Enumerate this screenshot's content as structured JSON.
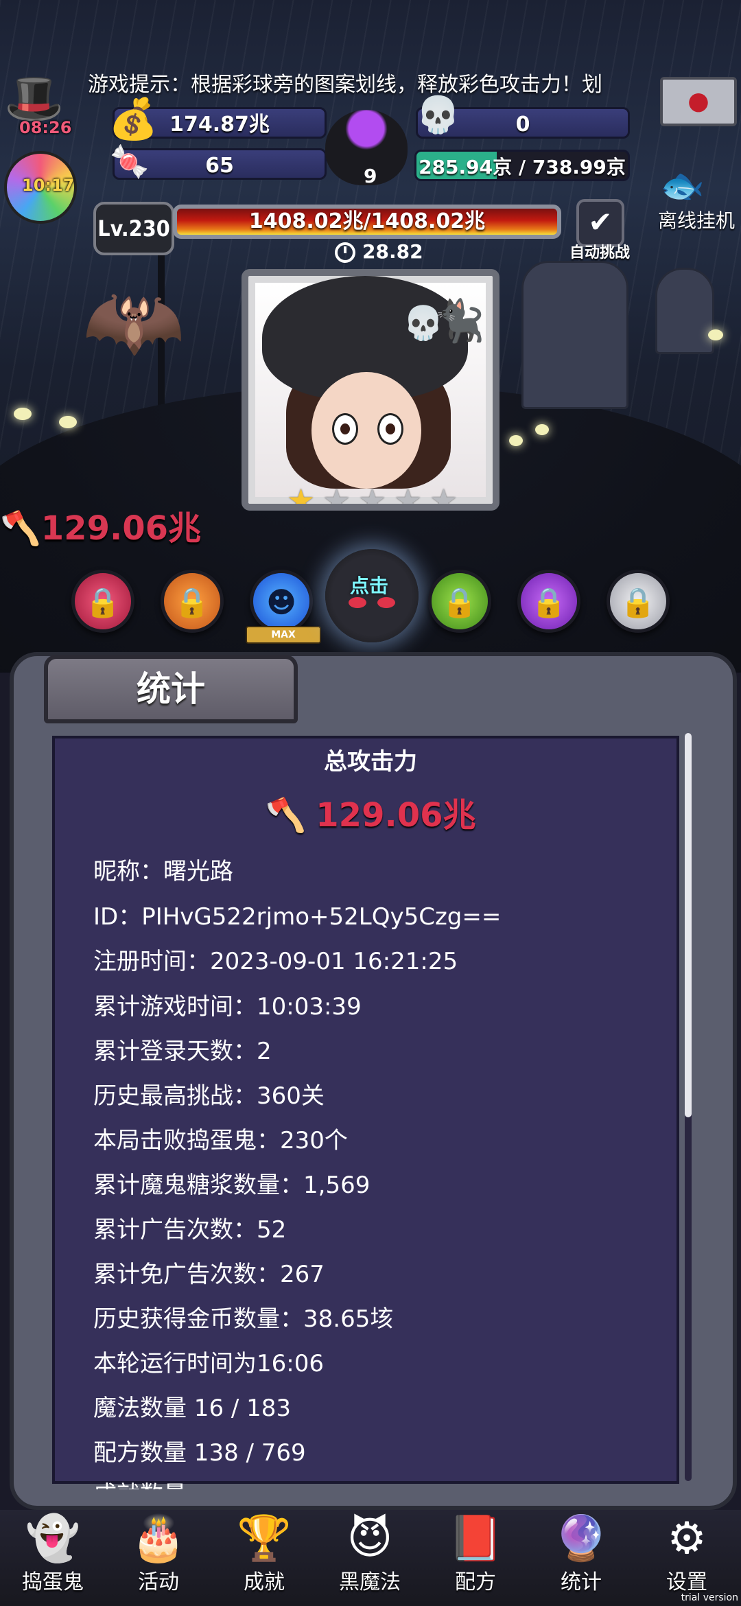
{
  "header": {
    "tip": "游戏提示：根据彩球旁的图案划线，释放彩色攻击力！划",
    "timer_hat": "08:26",
    "timer_candy": "10:17",
    "gold": "174.87兆",
    "candy": "65",
    "cauldron_count": "9",
    "skull_count": "0",
    "progress_text": "285.94京 / 738.99京"
  },
  "level": {
    "label": "Lv.230",
    "hp_text": "1408.02兆/1408.02兆",
    "timer": "28.82",
    "auto_label": "自动挑战",
    "offline_label": "离线挂机"
  },
  "scene": {
    "attack": "129.06兆",
    "stars_on": 1,
    "stars_total": 5,
    "tap_label": "点击",
    "max_label": "MAX"
  },
  "stats": {
    "tab_title": "统计",
    "total_title": "总攻击力",
    "total_value": "129.06兆",
    "lines": [
      "昵称：曙光路",
      "ID：PIHvG522rjmo+52LQy5Czg==",
      "注册时间：2023-09-01 16:21:25",
      "累计游戏时间：10:03:39",
      "累计登录天数：2",
      "历史最高挑战：360关",
      "本局击败捣蛋鬼：230个",
      "累计魔鬼糖浆数量：1,569",
      "累计广告次数：52",
      "累计免广告次数：267",
      "历史获得金币数量：38.65垓",
      "本轮运行时间为16:06",
      "魔法数量 16 / 183",
      "配方数量 138 / 769",
      "成就数量"
    ]
  },
  "nav": [
    {
      "label": "捣蛋鬼",
      "icon": "ghost-icon"
    },
    {
      "label": "活动",
      "icon": "cake-icon"
    },
    {
      "label": "成就",
      "icon": "trophy-icon"
    },
    {
      "label": "黑魔法",
      "icon": "demon-icon"
    },
    {
      "label": "配方",
      "icon": "book-icon"
    },
    {
      "label": "统计",
      "icon": "crystal-ball-icon"
    },
    {
      "label": "设置",
      "icon": "gear-icon"
    }
  ],
  "watermark": "trial version",
  "colors": {
    "attack_red": "#e0324e",
    "panel_bg": "#36305a",
    "timer_pink": "#f25a7a",
    "tap_cyan": "#7ef6ff"
  }
}
